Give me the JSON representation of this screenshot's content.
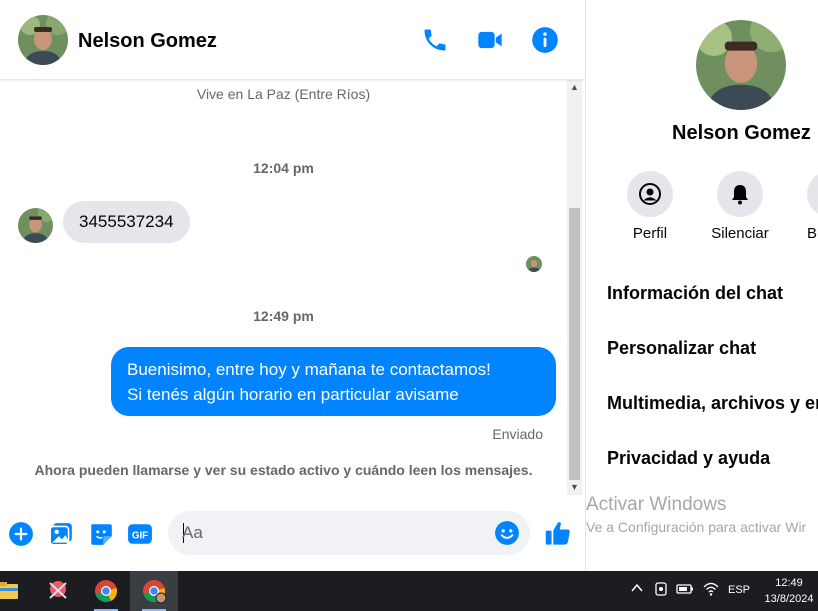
{
  "contact": {
    "name": "Nelson Gomez"
  },
  "header": {
    "icons": [
      "phone-icon",
      "video-camera-icon",
      "info-icon"
    ],
    "accent_color": "#0084ff"
  },
  "conversation": {
    "lives_in": "Vive en La Paz (Entre Ríos)",
    "time_1": "12:04 pm",
    "incoming_message": "3455537234",
    "time_2": "12:49 pm",
    "outgoing_message_line1": "Buenisimo, entre hoy y mañana te contactamos!",
    "outgoing_message_line2": "Si tenés algún horario en particular avisame",
    "status": "Enviado",
    "info_notice": "Ahora pueden llamarse y ver su estado activo y cuándo leen los mensajes."
  },
  "composer": {
    "placeholder": "Aa",
    "icons": [
      "plus-circle-icon",
      "image-icon",
      "sticker-icon",
      "gif-icon",
      "emoji-icon",
      "thumbs-up-icon"
    ],
    "gif_label": "GIF"
  },
  "side_panel": {
    "name": "Nelson Gomez",
    "actions": [
      {
        "label": "Perfil",
        "icon": "profile-icon"
      },
      {
        "label": "Silenciar",
        "icon": "bell-icon"
      },
      {
        "label": "Bu",
        "icon": "search-icon"
      }
    ],
    "menu": [
      "Información del chat",
      "Personalizar chat",
      "Multimedia, archivos y en",
      "Privacidad y ayuda"
    ],
    "watermark_title": "Activar Windows",
    "watermark_sub": "Ve a Configuración para activar Wir"
  },
  "taskbar": {
    "language": "ESP",
    "time": "12:49",
    "date": "13/8/2024"
  }
}
